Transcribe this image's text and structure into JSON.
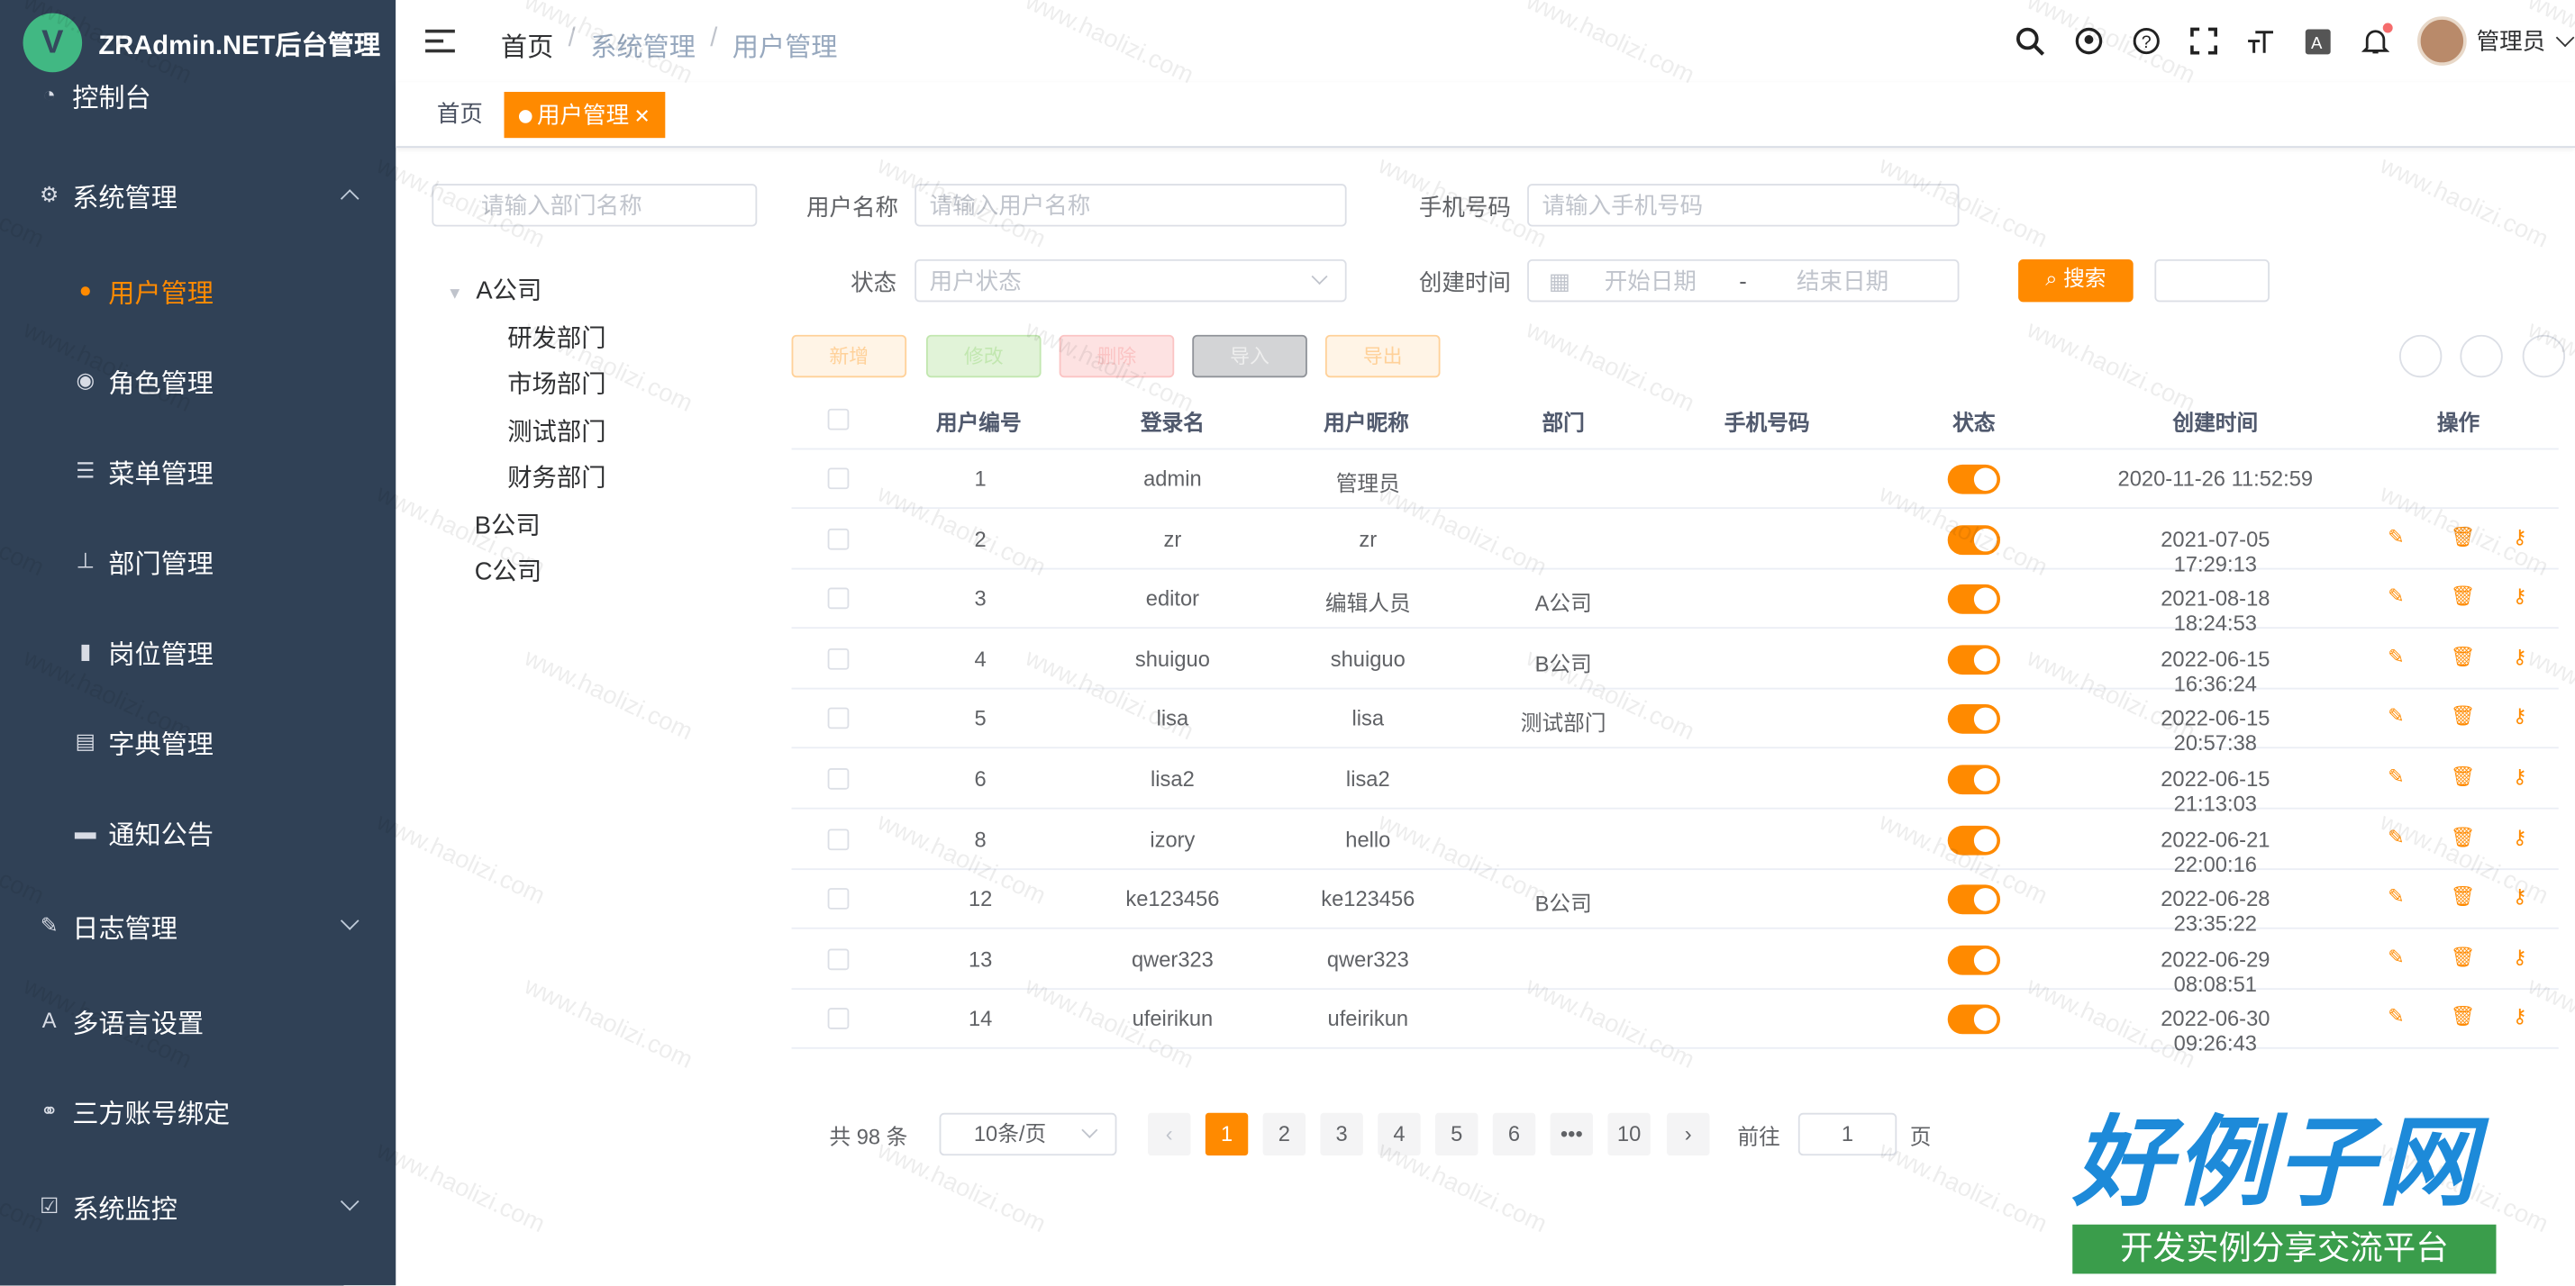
{
  "app": {
    "logo_letter": "V",
    "title": "ZRAdmin.NET后台管理"
  },
  "sidebar": {
    "dashboard": "控制台",
    "group_system": "系统管理",
    "items": [
      "用户管理",
      "角色管理",
      "菜单管理",
      "部门管理",
      "岗位管理",
      "字典管理",
      "通知公告"
    ],
    "log": "日志管理",
    "lang": "多语言设置",
    "third": "三方账号绑定",
    "monitor": "系统监控"
  },
  "breadcrumb": [
    "首页",
    "系统管理",
    "用户管理"
  ],
  "header": {
    "user": "管理员"
  },
  "tags": [
    "首页",
    "用户管理"
  ],
  "tree": {
    "search_placeholder": "请输入部门名称",
    "nodes": [
      {
        "label": "A公司",
        "children": [
          "研发部门",
          "市场部门",
          "测试部门",
          "财务部门"
        ]
      },
      {
        "label": "B公司"
      },
      {
        "label": "C公司"
      }
    ]
  },
  "filters": {
    "username_label": "用户名称",
    "username_placeholder": "请输入用户名称",
    "phone_label": "手机号码",
    "phone_placeholder": "请输入手机号码",
    "status_label": "状态",
    "status_placeholder": "用户状态",
    "created_label": "创建时间",
    "start_placeholder": "开始日期",
    "range_sep": "-",
    "end_placeholder": "结束日期",
    "search_btn": "搜索"
  },
  "toolbar": {
    "add": "新增",
    "edit": "修改",
    "delete": "删除",
    "import": "导入",
    "export": "导出"
  },
  "table": {
    "headers": [
      "用户编号",
      "登录名",
      "用户昵称",
      "部门",
      "手机号码",
      "状态",
      "创建时间",
      "操作"
    ],
    "rows": [
      {
        "id": "1",
        "login": "admin",
        "nick": "管理员",
        "dept": "",
        "phone": "",
        "time": "2020-11-26 11:52:59",
        "ops": false
      },
      {
        "id": "2",
        "login": "zr",
        "nick": "zr",
        "dept": "",
        "phone": "",
        "time": "2021-07-05 17:29:13",
        "ops": true
      },
      {
        "id": "3",
        "login": "editor",
        "nick": "编辑人员",
        "dept": "A公司",
        "phone": "",
        "time": "2021-08-18 18:24:53",
        "ops": true
      },
      {
        "id": "4",
        "login": "shuiguo",
        "nick": "shuiguo",
        "dept": "B公司",
        "phone": "",
        "time": "2022-06-15 16:36:24",
        "ops": true
      },
      {
        "id": "5",
        "login": "lisa",
        "nick": "lisa",
        "dept": "测试部门",
        "phone": "",
        "time": "2022-06-15 20:57:38",
        "ops": true
      },
      {
        "id": "6",
        "login": "lisa2",
        "nick": "lisa2",
        "dept": "",
        "phone": "",
        "time": "2022-06-15 21:13:03",
        "ops": true
      },
      {
        "id": "8",
        "login": "izory",
        "nick": "hello",
        "dept": "",
        "phone": "",
        "time": "2022-06-21 22:00:16",
        "ops": true
      },
      {
        "id": "12",
        "login": "ke123456",
        "nick": "ke123456",
        "dept": "B公司",
        "phone": "",
        "time": "2022-06-28 23:35:22",
        "ops": true
      },
      {
        "id": "13",
        "login": "qwer323",
        "nick": "qwer323",
        "dept": "",
        "phone": "",
        "time": "2022-06-29 08:08:51",
        "ops": true
      },
      {
        "id": "14",
        "login": "ufeirikun",
        "nick": "ufeirikun",
        "dept": "",
        "phone": "",
        "time": "2022-06-30 09:26:43",
        "ops": true
      }
    ]
  },
  "pagination": {
    "total": "共 98 条",
    "size": "10条/页",
    "pages": [
      "1",
      "2",
      "3",
      "4",
      "5",
      "6",
      "•••",
      "10"
    ],
    "goto": "前往",
    "goto_value": "1",
    "page_unit": "页"
  },
  "watermark": "www.haolizi.com",
  "brand": {
    "big": "好例子网",
    "small": "开发实例分享交流平台"
  },
  "colors": {
    "accent": "#ff8a00",
    "sidebar": "#304156"
  }
}
